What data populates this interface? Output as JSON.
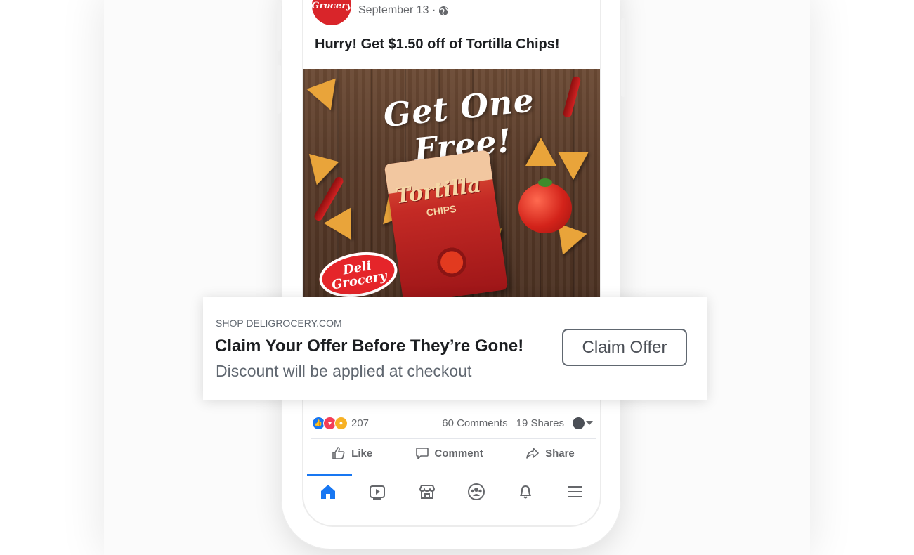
{
  "post": {
    "page_logo_text": "Grocery",
    "date": "September 13 ·",
    "text": "Hurry! Get $1.50 off of Tortilla Chips!"
  },
  "ad_image": {
    "headline": "Get One Free!",
    "bag_brand": "Tortilla",
    "bag_sub": "CHIPS",
    "badge_line1": "Deli",
    "badge_line2": "Grocery"
  },
  "offer": {
    "domain": "SHOP DELIGROCERY.COM",
    "title": "Claim Your Offer Before They’re Gone!",
    "description": "Discount will be applied at checkout",
    "button_label": "Claim Offer"
  },
  "stats": {
    "reaction_count": "207",
    "comments": "60 Comments",
    "shares": "19 Shares"
  },
  "actions": {
    "like": "Like",
    "comment": "Comment",
    "share": "Share"
  },
  "tabbar": {
    "tabs": [
      "home-icon",
      "video-icon",
      "marketplace-icon",
      "groups-icon",
      "notifications-icon",
      "menu-icon"
    ],
    "active": "home-icon",
    "accent": "#1877f2"
  },
  "colors": {
    "brand_red": "#d9252a",
    "text_primary": "#1c1e21",
    "text_secondary": "#65676b"
  }
}
